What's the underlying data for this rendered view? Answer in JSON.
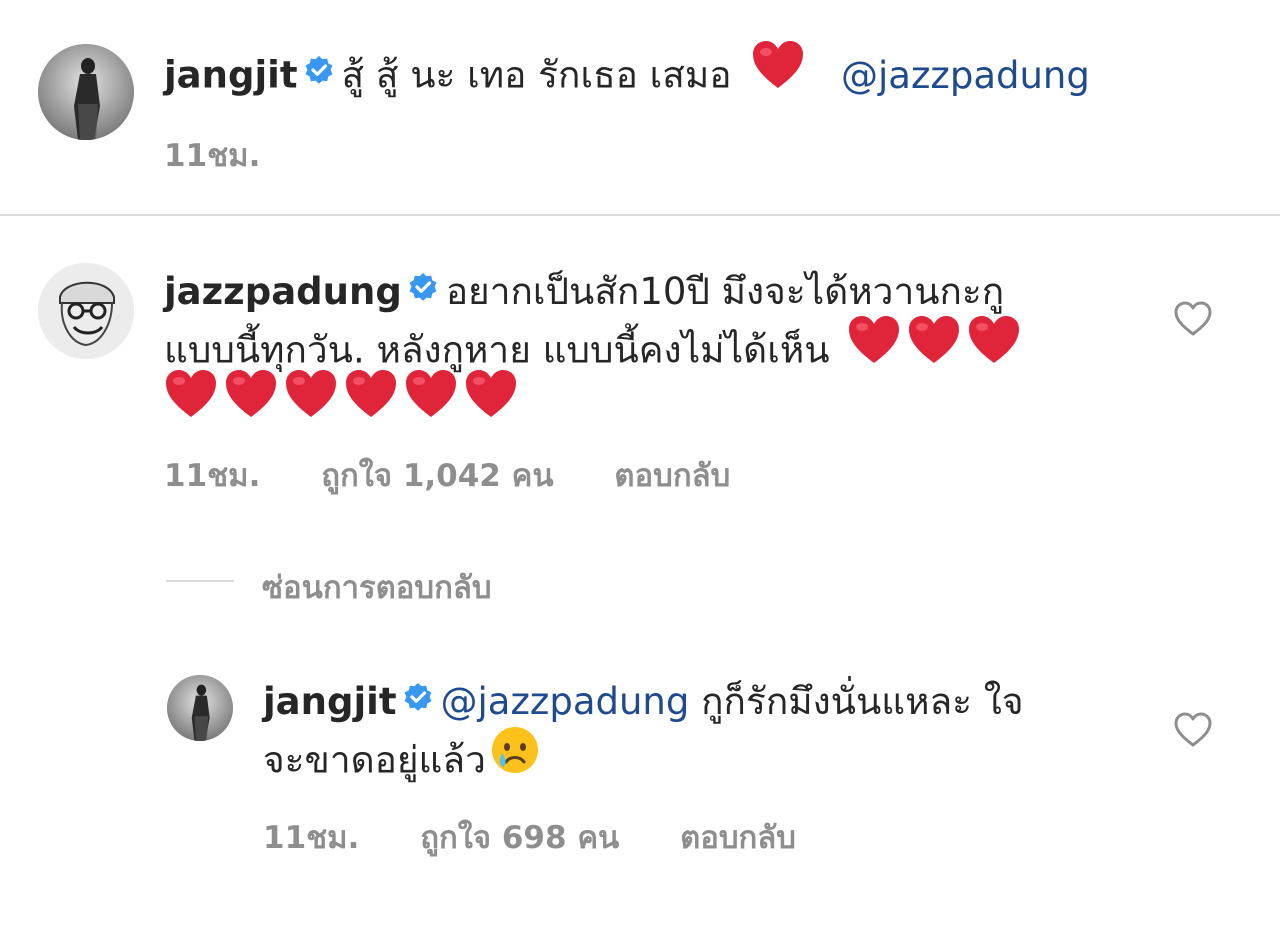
{
  "colors": {
    "mention": "#1f4b8e",
    "meta": "#8e8e8e",
    "verified": "#3897f0",
    "heart": "#e0243a"
  },
  "caption": {
    "username": "jangjit",
    "text": "สู้ สู้ นะ เทอ รักเธอ เสมอ",
    "emoji": "red-heart",
    "mention": "@jazzpadung",
    "time": "11ชม."
  },
  "comment": {
    "username": "jazzpadung",
    "text_line1": "อยากเป็นสัก10ปี มึงจะได้หวานกะกู",
    "text_line2": "แบบนี้ทุกวัน. หลังกูหาย แบบนี้คงไม่ได้เห็น",
    "hearts_line2": 3,
    "hearts_line3": 6,
    "time": "11ชม.",
    "likes": "ถูกใจ 1,042 คน",
    "reply_label": "ตอบกลับ"
  },
  "hide_replies": "ซ่อนการตอบกลับ",
  "reply": {
    "username": "jangjit",
    "mention": "@jazzpadung",
    "text_line1": "กูก็รักมึงนั่นแหละ ใจ",
    "text_line2": "จะขาดอยู่แล้ว",
    "emoji": "crying-face",
    "time": "11ชม.",
    "likes": "ถูกใจ 698 คน",
    "reply_label": "ตอบกลับ"
  }
}
